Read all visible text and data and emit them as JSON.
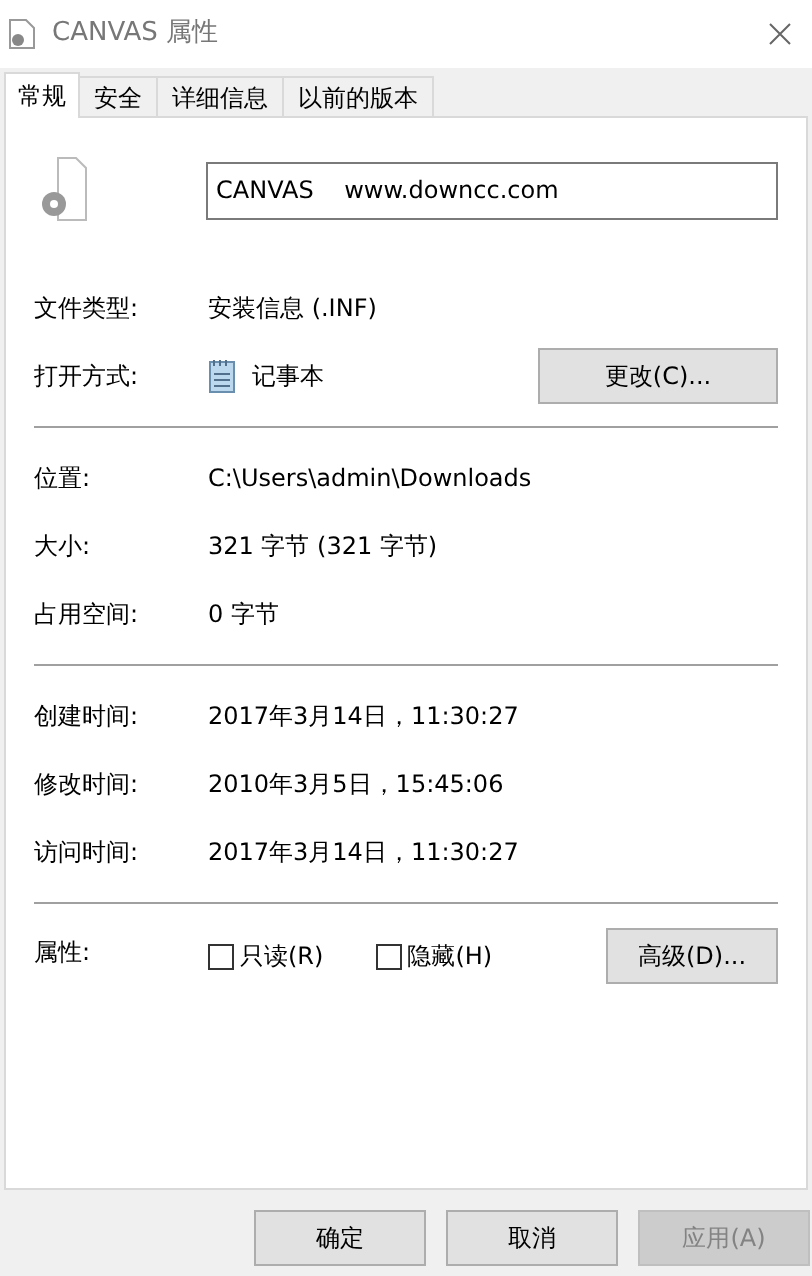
{
  "window": {
    "title": "CANVAS 属性"
  },
  "tabs": [
    {
      "label": "常规",
      "selected": true
    },
    {
      "label": "安全",
      "selected": false
    },
    {
      "label": "详细信息",
      "selected": false
    },
    {
      "label": "以前的版本",
      "selected": false
    }
  ],
  "file_name": "CANVAS    www.downcc.com",
  "sections": [
    [
      {
        "kind": "text",
        "label": "文件类型:",
        "value": "安装信息 (.INF)"
      },
      {
        "kind": "opener",
        "label": "打开方式:",
        "value": "记事本",
        "button": "更改(C)..."
      }
    ],
    [
      {
        "kind": "text",
        "label": "位置:",
        "value": "C:\\Users\\admin\\Downloads"
      },
      {
        "kind": "text",
        "label": "大小:",
        "value": "321 字节 (321 字节)"
      },
      {
        "kind": "text",
        "label": "占用空间:",
        "value": "0 字节"
      }
    ],
    [
      {
        "kind": "text",
        "label": "创建时间:",
        "value": "2017年3月14日，11:30:27"
      },
      {
        "kind": "text",
        "label": "修改时间:",
        "value": "2010年3月5日，15:45:06"
      },
      {
        "kind": "text",
        "label": "访问时间:",
        "value": "2017年3月14日，11:30:27"
      }
    ],
    [
      {
        "kind": "attributes",
        "label": "属性:",
        "checkboxes": [
          {
            "label": "只读(R)",
            "checked": false
          },
          {
            "label": "隐藏(H)",
            "checked": false
          }
        ],
        "button": "高级(D)..."
      }
    ]
  ],
  "buttons": [
    {
      "label": "确定",
      "disabled": false
    },
    {
      "label": "取消",
      "disabled": false
    },
    {
      "label": "应用(A)",
      "disabled": true
    }
  ]
}
